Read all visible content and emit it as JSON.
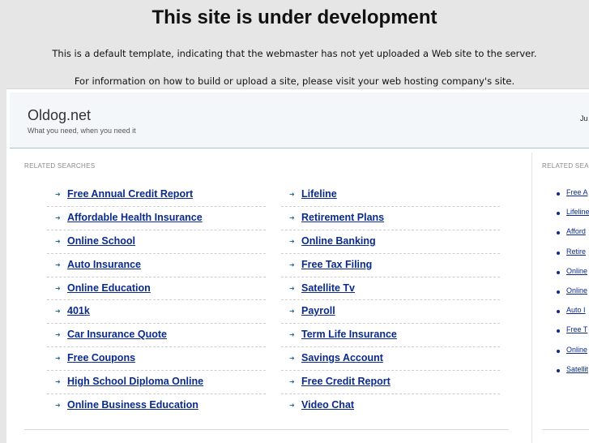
{
  "notice": {
    "title": "This site is under development",
    "line1": "This is a default template, indicating that the webmaster has not yet uploaded a Web site to the server.",
    "line2": "For information on how to build or upload a site, please visit your web hosting company's site."
  },
  "header": {
    "site_name": "Oldog.net",
    "tagline": "What you need, when you need it",
    "date_fragment": "Ju"
  },
  "main": {
    "section_label": "RELATED SEARCHES",
    "left_links": [
      "Free Annual Credit Report",
      "Affordable Health Insurance",
      "Online School",
      "Auto Insurance",
      "Online Education",
      "401k",
      "Car Insurance Quote",
      "Free Coupons",
      "High School Diploma Online",
      "Online Business Education"
    ],
    "right_links": [
      "Lifeline",
      "Retirement Plans",
      "Online Banking",
      "Free Tax Filing",
      "Satellite Tv",
      "Payroll",
      "Term Life Insurance",
      "Savings Account",
      "Free Credit Report",
      "Video Chat"
    ]
  },
  "sidebar": {
    "section_label": "RELATED SEA",
    "links": [
      "Free A",
      "Lifeline",
      "Afford",
      "Retire",
      "Online",
      "Online",
      "Auto I",
      "Free T",
      "Online",
      "Satellit"
    ]
  },
  "colors": {
    "link": "#0a2a8c",
    "arrow": "#2b6a99",
    "background": "#e6e6e6"
  },
  "icons": {
    "link_arrow": "arrow-right-icon",
    "side_bullet": "bullet-icon"
  }
}
